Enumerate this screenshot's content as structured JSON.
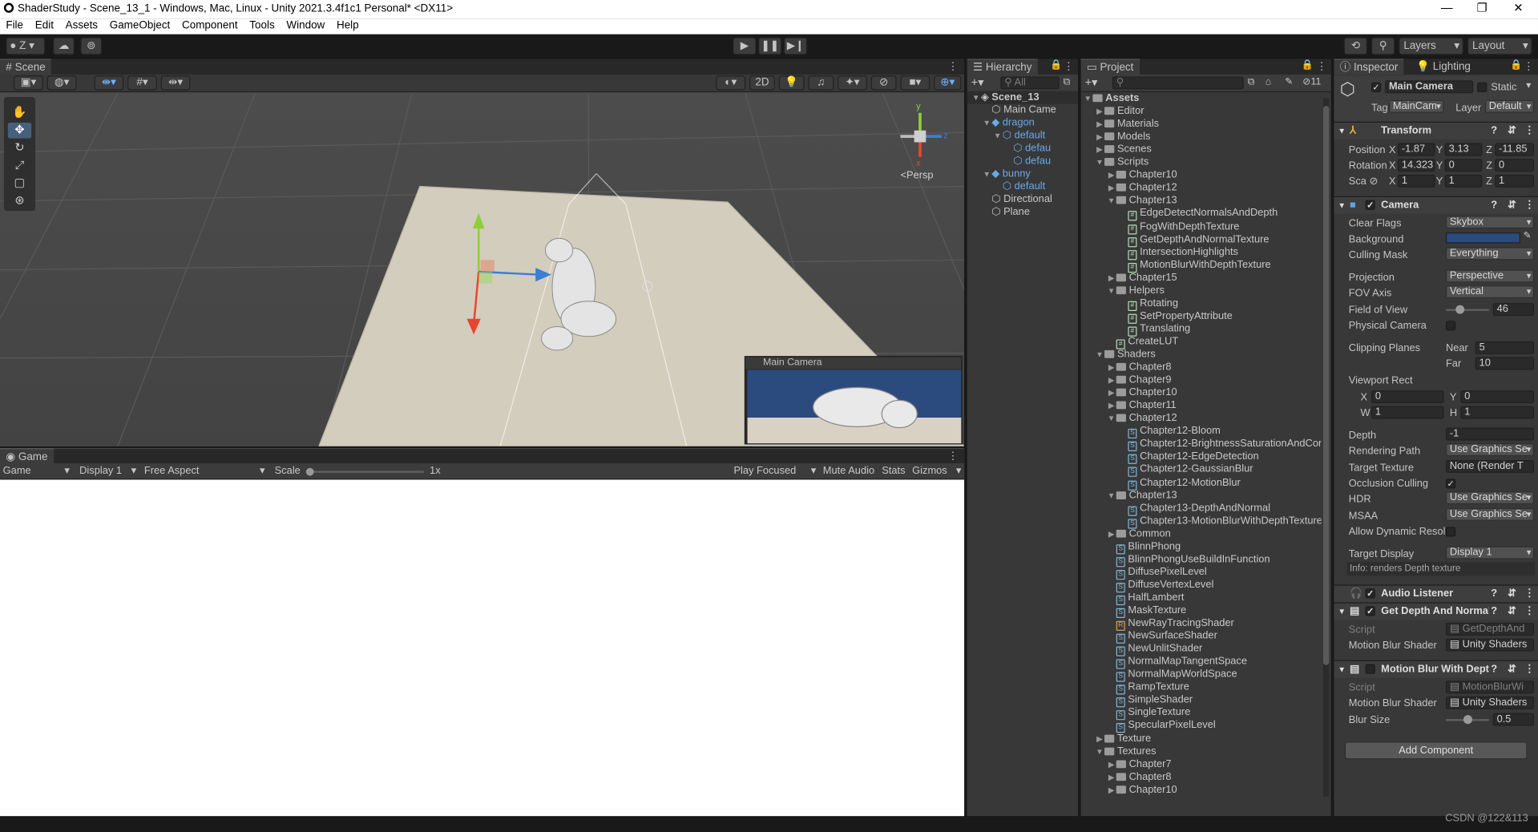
{
  "window": {
    "title": "ShaderStudy - Scene_13_1 - Windows, Mac, Linux - Unity 2021.3.4f1c1 Personal* <DX11>"
  },
  "menu": [
    "File",
    "Edit",
    "Assets",
    "GameObject",
    "Component",
    "Tools",
    "Window",
    "Help"
  ],
  "toolbar": {
    "account": "Z",
    "layers": "Layers",
    "layout": "Layout"
  },
  "scene": {
    "tab": "Scene",
    "toggle_2d": "2D",
    "gizmo_persp": "Persp",
    "axis_x": "x",
    "axis_y": "y",
    "axis_z": "z",
    "overlay_title": "Main Camera"
  },
  "game": {
    "tab": "Game",
    "mode": "Game",
    "display": "Display 1",
    "aspect": "Free Aspect",
    "scale_label": "Scale",
    "scale_value": "1x",
    "play_focused": "Play Focused",
    "mute_audio": "Mute Audio",
    "stats": "Stats",
    "gizmos": "Gizmos"
  },
  "hierarchy": {
    "tab": "Hierarchy",
    "search_placeholder": "All",
    "items": [
      {
        "label": "Scene_13",
        "depth": 0,
        "icon": "scene",
        "expanded": true
      },
      {
        "label": "Main Came",
        "depth": 1,
        "icon": "cube"
      },
      {
        "label": "dragon",
        "depth": 1,
        "icon": "prefab",
        "expanded": true,
        "blue": true
      },
      {
        "label": "default",
        "depth": 2,
        "icon": "cube",
        "expanded": true,
        "blue": true
      },
      {
        "label": "defau",
        "depth": 3,
        "icon": "cube",
        "blue": true
      },
      {
        "label": "defau",
        "depth": 3,
        "icon": "cube",
        "blue": true
      },
      {
        "label": "bunny",
        "depth": 1,
        "icon": "prefab",
        "expanded": true,
        "blue": true
      },
      {
        "label": "default",
        "depth": 2,
        "icon": "cube",
        "blue": true
      },
      {
        "label": "Directional",
        "depth": 1,
        "icon": "cube"
      },
      {
        "label": "Plane",
        "depth": 1,
        "icon": "cube"
      }
    ]
  },
  "project": {
    "tab": "Project",
    "hidden_count": "11",
    "items": [
      {
        "label": "Assets",
        "depth": 0,
        "type": "folder",
        "tri": "down"
      },
      {
        "label": "Editor",
        "depth": 1,
        "type": "folder",
        "tri": "right"
      },
      {
        "label": "Materials",
        "depth": 1,
        "type": "folder",
        "tri": "right"
      },
      {
        "label": "Models",
        "depth": 1,
        "type": "folder",
        "tri": "right"
      },
      {
        "label": "Scenes",
        "depth": 1,
        "type": "folder",
        "tri": "right"
      },
      {
        "label": "Scripts",
        "depth": 1,
        "type": "folder",
        "tri": "down"
      },
      {
        "label": "Chapter10",
        "depth": 2,
        "type": "folder",
        "tri": "right"
      },
      {
        "label": "Chapter12",
        "depth": 2,
        "type": "folder",
        "tri": "right"
      },
      {
        "label": "Chapter13",
        "depth": 2,
        "type": "folder",
        "tri": "down"
      },
      {
        "label": "EdgeDetectNormalsAndDepth",
        "depth": 3,
        "type": "script"
      },
      {
        "label": "FogWithDepthTexture",
        "depth": 3,
        "type": "script"
      },
      {
        "label": "GetDepthAndNormalTexture",
        "depth": 3,
        "type": "script"
      },
      {
        "label": "IntersectionHighlights",
        "depth": 3,
        "type": "script"
      },
      {
        "label": "MotionBlurWithDepthTexture",
        "depth": 3,
        "type": "script"
      },
      {
        "label": "Chapter15",
        "depth": 2,
        "type": "folder",
        "tri": "right"
      },
      {
        "label": "Helpers",
        "depth": 2,
        "type": "folder",
        "tri": "down"
      },
      {
        "label": "Rotating",
        "depth": 3,
        "type": "script"
      },
      {
        "label": "SetPropertyAttribute",
        "depth": 3,
        "type": "script"
      },
      {
        "label": "Translating",
        "depth": 3,
        "type": "script"
      },
      {
        "label": "CreateLUT",
        "depth": 2,
        "type": "script"
      },
      {
        "label": "Shaders",
        "depth": 1,
        "type": "folder",
        "tri": "down"
      },
      {
        "label": "Chapter8",
        "depth": 2,
        "type": "folder",
        "tri": "right"
      },
      {
        "label": "Chapter9",
        "depth": 2,
        "type": "folder",
        "tri": "right"
      },
      {
        "label": "Chapter10",
        "depth": 2,
        "type": "folder",
        "tri": "right"
      },
      {
        "label": "Chapter11",
        "depth": 2,
        "type": "folder",
        "tri": "right"
      },
      {
        "label": "Chapter12",
        "depth": 2,
        "type": "folder",
        "tri": "down"
      },
      {
        "label": "Chapter12-Bloom",
        "depth": 3,
        "type": "shader"
      },
      {
        "label": "Chapter12-BrightnessSaturationAndCor",
        "depth": 3,
        "type": "shader"
      },
      {
        "label": "Chapter12-EdgeDetection",
        "depth": 3,
        "type": "shader"
      },
      {
        "label": "Chapter12-GaussianBlur",
        "depth": 3,
        "type": "shader"
      },
      {
        "label": "Chapter12-MotionBlur",
        "depth": 3,
        "type": "shader"
      },
      {
        "label": "Chapter13",
        "depth": 2,
        "type": "folder",
        "tri": "down"
      },
      {
        "label": "Chapter13-DepthAndNormal",
        "depth": 3,
        "type": "shader"
      },
      {
        "label": "Chapter13-MotionBlurWithDepthTexture",
        "depth": 3,
        "type": "shader"
      },
      {
        "label": "Common",
        "depth": 2,
        "type": "folder",
        "tri": "right"
      },
      {
        "label": "BlinnPhong",
        "depth": 2,
        "type": "shader"
      },
      {
        "label": "BlinnPhongUseBuildInFunction",
        "depth": 2,
        "type": "shader"
      },
      {
        "label": "DiffusePixelLevel",
        "depth": 2,
        "type": "shader"
      },
      {
        "label": "DiffuseVertexLevel",
        "depth": 2,
        "type": "shader"
      },
      {
        "label": "HalfLambert",
        "depth": 2,
        "type": "shader"
      },
      {
        "label": "MaskTexture",
        "depth": 2,
        "type": "shader"
      },
      {
        "label": "NewRayTracingShader",
        "depth": 2,
        "type": "raytrace"
      },
      {
        "label": "NewSurfaceShader",
        "depth": 2,
        "type": "shader"
      },
      {
        "label": "NewUnlitShader",
        "depth": 2,
        "type": "shader"
      },
      {
        "label": "NormalMapTangentSpace",
        "depth": 2,
        "type": "shader"
      },
      {
        "label": "NormalMapWorldSpace",
        "depth": 2,
        "type": "shader"
      },
      {
        "label": "RampTexture",
        "depth": 2,
        "type": "shader"
      },
      {
        "label": "SimpleShader",
        "depth": 2,
        "type": "shader"
      },
      {
        "label": "SingleTexture",
        "depth": 2,
        "type": "shader"
      },
      {
        "label": "SpecularPixelLevel",
        "depth": 2,
        "type": "shader"
      },
      {
        "label": "Texture",
        "depth": 1,
        "type": "folder",
        "tri": "right"
      },
      {
        "label": "Textures",
        "depth": 1,
        "type": "folder",
        "tri": "down"
      },
      {
        "label": "Chapter7",
        "depth": 2,
        "type": "folder",
        "tri": "right"
      },
      {
        "label": "Chapter8",
        "depth": 2,
        "type": "folder",
        "tri": "right"
      },
      {
        "label": "Chapter10",
        "depth": 2,
        "type": "folder",
        "tri": "right"
      }
    ]
  },
  "inspector": {
    "tab": "Inspector",
    "tab2": "Lighting",
    "object_name": "Main Camera",
    "static": "Static",
    "tag_label": "Tag",
    "tag_value": "MainCam",
    "layer_label": "Layer",
    "layer_value": "Default",
    "transform": {
      "title": "Transform",
      "position_label": "Position",
      "rotation_label": "Rotation",
      "scale_label": "Sca",
      "pos": [
        "-1.87",
        "3.13",
        "-11.85"
      ],
      "rot": [
        "14.323",
        "0",
        "0"
      ],
      "scl": [
        "1",
        "1",
        "1"
      ],
      "x": "X",
      "y": "Y",
      "z": "Z"
    },
    "camera": {
      "title": "Camera",
      "clear_flags_label": "Clear Flags",
      "clear_flags": "Skybox",
      "background_label": "Background",
      "background_color": "#2b4a7e",
      "culling_mask_label": "Culling Mask",
      "culling_mask": "Everything",
      "projection_label": "Projection",
      "projection": "Perspective",
      "fov_axis_label": "FOV Axis",
      "fov_axis": "Vertical",
      "fov_label": "Field of View",
      "fov": "46",
      "physical_label": "Physical Camera",
      "clipping_label": "Clipping Planes",
      "near_label": "Near",
      "near": "5",
      "far_label": "Far",
      "far": "10",
      "viewport_label": "Viewport Rect",
      "vx": "0",
      "vy": "0",
      "vw": "1",
      "vh": "1",
      "vx_label": "X",
      "vy_label": "Y",
      "vw_label": "W",
      "vh_label": "H",
      "depth_label": "Depth",
      "depth": "-1",
      "rendering_path_label": "Rendering Path",
      "rendering_path": "Use Graphics Se",
      "target_texture_label": "Target Texture",
      "target_texture": "None (Render T",
      "occlusion_label": "Occlusion Culling",
      "hdr_label": "HDR",
      "hdr": "Use Graphics Se",
      "msaa_label": "MSAA",
      "msaa": "Use Graphics Se",
      "dynamic_res_label": "Allow Dynamic Resol",
      "target_display_label": "Target Display",
      "target_display": "Display 1",
      "info": "Info: renders Depth texture"
    },
    "audio_listener": {
      "title": "Audio Listener"
    },
    "get_depth": {
      "title": "Get Depth And Normal",
      "script_label": "Script",
      "script": "GetDepthAnd",
      "shader_label": "Motion Blur Shader",
      "shader": "Unity Shaders"
    },
    "motion_blur": {
      "title": "Motion Blur With Deptl",
      "script_label": "Script",
      "script": "MotionBlurWi",
      "shader_label": "Motion Blur Shader",
      "shader": "Unity Shaders",
      "blur_label": "Blur Size",
      "blur": "0.5"
    },
    "add_component": "Add Component"
  },
  "status": {
    "watermark": "CSDN @122&113"
  }
}
